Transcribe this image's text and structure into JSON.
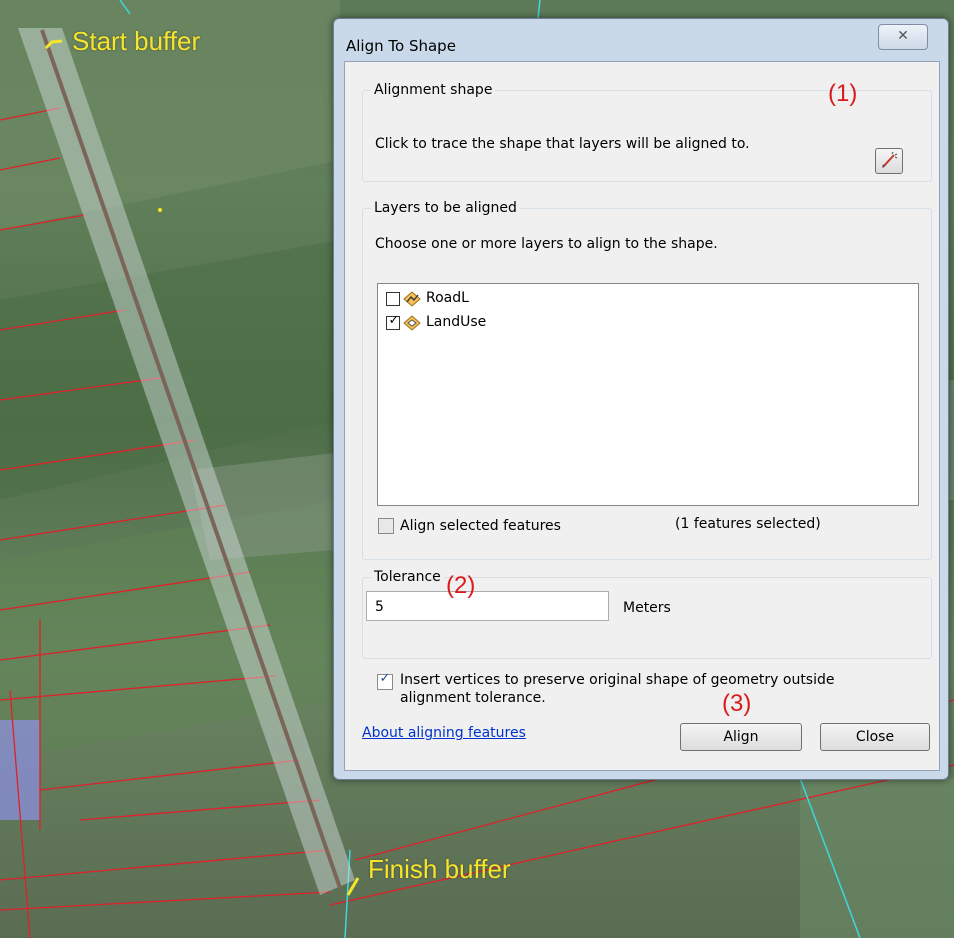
{
  "map": {
    "start_label": "Start buffer",
    "finish_label": "Finish buffer",
    "callouts": [
      "(1)",
      "(2)",
      "(3)"
    ]
  },
  "dialog": {
    "title": "Align To Shape",
    "close_glyph": "✕",
    "alignment_shape": {
      "group_label": "Alignment shape",
      "instruction": "Click to trace the shape that layers will be aligned to."
    },
    "layers": {
      "group_label": "Layers to be aligned",
      "instruction": "Choose one or more layers to align to the shape.",
      "items": [
        {
          "name": "RoadL",
          "checked": false
        },
        {
          "name": "LandUse",
          "checked": true
        }
      ],
      "align_selected_label": "Align selected features",
      "selected_count": "(1 features selected)"
    },
    "tolerance": {
      "group_label": "Tolerance",
      "value": "5",
      "units": "Meters"
    },
    "insert_vertices_label_1": "Insert vertices to preserve original shape of geometry outside",
    "insert_vertices_label_2": "alignment tolerance.",
    "about_link": "About aligning features",
    "align_button": "Align",
    "close_button": "Close"
  },
  "colors": {
    "annotation_yellow": "#f5e628",
    "annotation_red": "#d91b1b",
    "parcel_red": "#e0202a",
    "dialog_frame": "#c9d9ea"
  }
}
